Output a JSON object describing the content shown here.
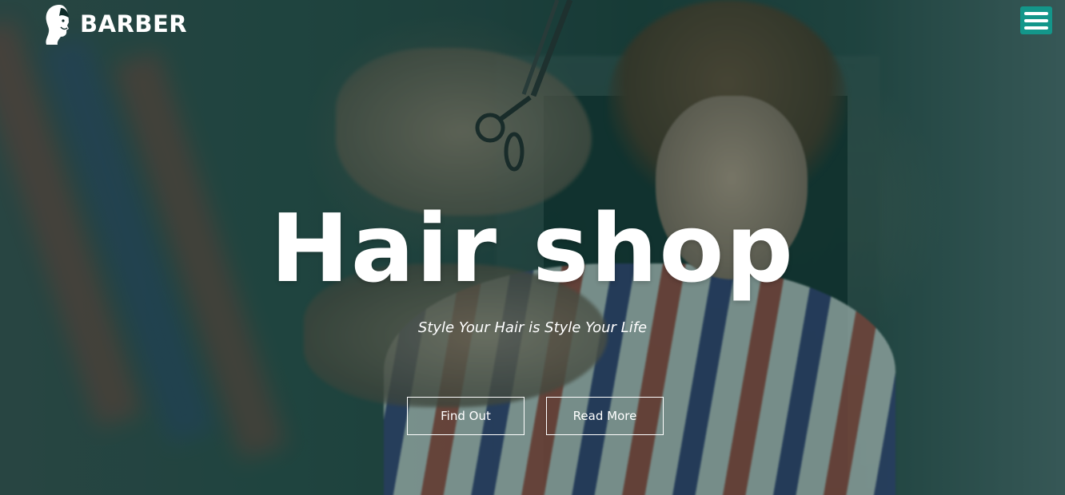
{
  "header": {
    "brand_name": "BARBER",
    "logo_icon": "barber-head-icon",
    "menu_icon": "hamburger-menu-icon"
  },
  "hero": {
    "title": "Hair shop",
    "subtitle": "Style Your Hair is Style Your Life",
    "buttons": {
      "find_out": "Find Out",
      "read_more": "Read More"
    }
  },
  "colors": {
    "accent": "#13968a",
    "overlay": "#0a3c37",
    "text": "#ffffff"
  }
}
